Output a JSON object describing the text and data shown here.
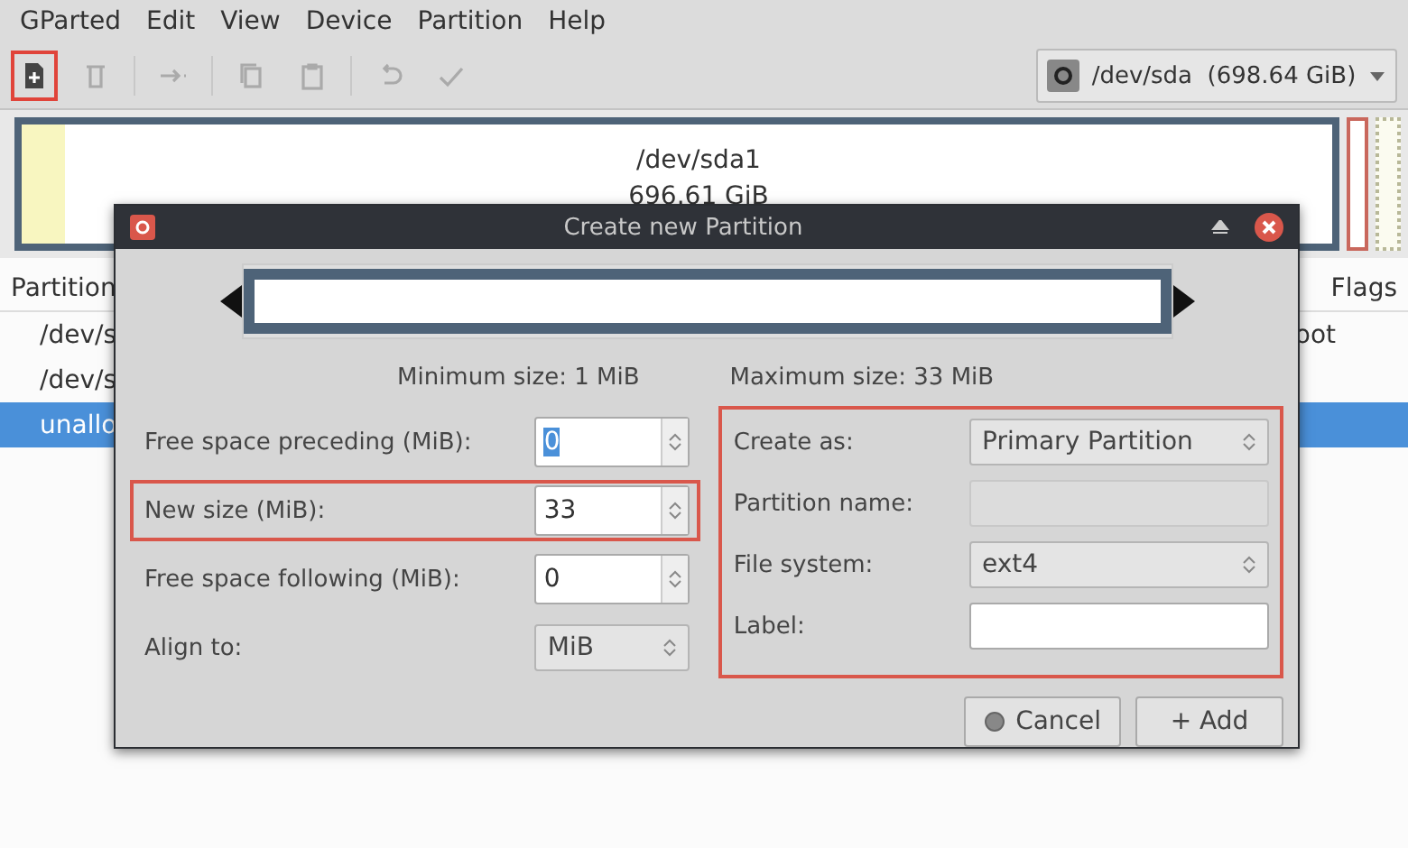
{
  "menu": [
    "GParted",
    "Edit",
    "View",
    "Device",
    "Partition",
    "Help"
  ],
  "toolbar": [
    {
      "kind": "new",
      "disabled": false,
      "highlighted": true
    },
    {
      "kind": "delete",
      "disabled": true,
      "highlighted": false
    },
    {
      "kind": "resize",
      "disabled": true,
      "highlighted": false
    },
    {
      "kind": "copy",
      "disabled": true,
      "highlighted": false
    },
    {
      "kind": "paste",
      "disabled": true,
      "highlighted": false
    },
    {
      "kind": "undo",
      "disabled": true,
      "highlighted": false
    },
    {
      "kind": "apply",
      "disabled": true,
      "highlighted": false
    }
  ],
  "device": "/dev/sda  (698.64 GiB)",
  "disk_map": {
    "name": "/dev/sda1",
    "size": "696.61 GiB"
  },
  "table": {
    "columns": [
      "Partition",
      "Flags"
    ],
    "rows": [
      {
        "cells": [
          "/dev/s",
          "oot"
        ],
        "selected": false
      },
      {
        "cells": [
          "/dev/s",
          ""
        ],
        "selected": false
      },
      {
        "cells": [
          "unallo",
          ""
        ],
        "selected": true
      }
    ]
  },
  "dialog": {
    "title": "Create new Partition",
    "slider": {
      "level": 1
    },
    "minimum": "Minimum size: 1 MiB",
    "maximum": "Maximum size: 33 MiB",
    "left": [
      {
        "kind": "spin",
        "label": "Free space preceding (MiB):",
        "value": "0",
        "highlighted": false,
        "text_selected": true
      },
      {
        "kind": "spin",
        "label": "New size (MiB):",
        "value": "33",
        "highlighted": true
      },
      {
        "kind": "spin",
        "label": "Free space following (MiB):",
        "value": "0",
        "highlighted": false
      },
      {
        "kind": "combo",
        "label": "Align to:",
        "value": "MiB",
        "highlighted": false
      }
    ],
    "right": [
      {
        "kind": "combo",
        "label": "Create as:",
        "value": "Primary Partition",
        "disabled": false
      },
      {
        "kind": "entry",
        "label": "Partition name:",
        "disabled": true
      },
      {
        "kind": "combo",
        "label": "File system:",
        "value": "ext4",
        "disabled": false
      },
      {
        "kind": "entry",
        "label": "Label:",
        "disabled": false
      }
    ],
    "buttons": [
      {
        "kind": "cancel",
        "label": "Cancel"
      },
      {
        "kind": "add",
        "label": "+ Add"
      }
    ]
  }
}
